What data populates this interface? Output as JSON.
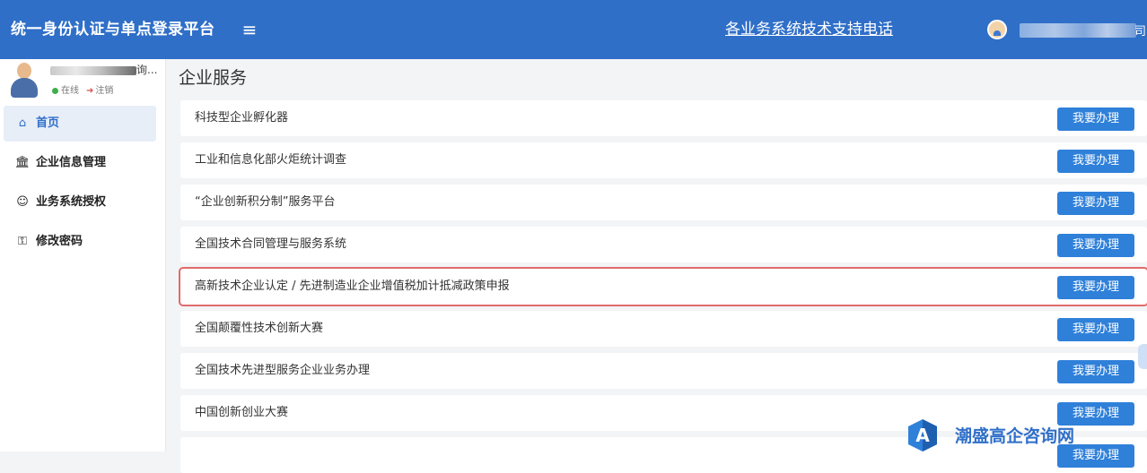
{
  "header": {
    "brand": "统一身份认证与单点登录平台",
    "menu_icon": "hamburger-icon",
    "support_link": "各业务系统技术支持电话",
    "user_name_tail": "司",
    "colors": {
      "header_bg": "#2f6fc8"
    }
  },
  "sidebar": {
    "profile": {
      "name_tail": "询...",
      "online_label": "在线",
      "logout_label": "注销"
    },
    "items": [
      {
        "icon": "home-icon",
        "icon_glyph": "⌂",
        "label": "首页",
        "active": true
      },
      {
        "icon": "bank-icon",
        "icon_glyph": "⌂",
        "label": "企业信息管理",
        "active": false
      },
      {
        "icon": "users-icon",
        "icon_glyph": "☺",
        "label": "业务系统授权",
        "active": false
      },
      {
        "icon": "key-icon",
        "icon_glyph": "⚿",
        "label": "修改密码",
        "active": false
      }
    ]
  },
  "main": {
    "title": "企业服务",
    "action_label": "我要办理",
    "services": [
      {
        "label": "科技型企业孵化器",
        "highlighted": false
      },
      {
        "label": "工业和信息化部火炬统计调查",
        "highlighted": false
      },
      {
        "label": "“企业创新积分制”服务平台",
        "highlighted": false
      },
      {
        "label": "全国技术合同管理与服务系统",
        "highlighted": false
      },
      {
        "label": "高新技术企业认定 / 先进制造业企业增值税加计抵减政策申报",
        "highlighted": true
      },
      {
        "label": "全国颠覆性技术创新大赛",
        "highlighted": false
      },
      {
        "label": "全国技术先进型服务企业业务办理",
        "highlighted": false
      },
      {
        "label": "中国创新创业大赛",
        "highlighted": false
      }
    ]
  },
  "watermark": {
    "logo_letter": "A",
    "text": "潮盛高企咨询网"
  }
}
